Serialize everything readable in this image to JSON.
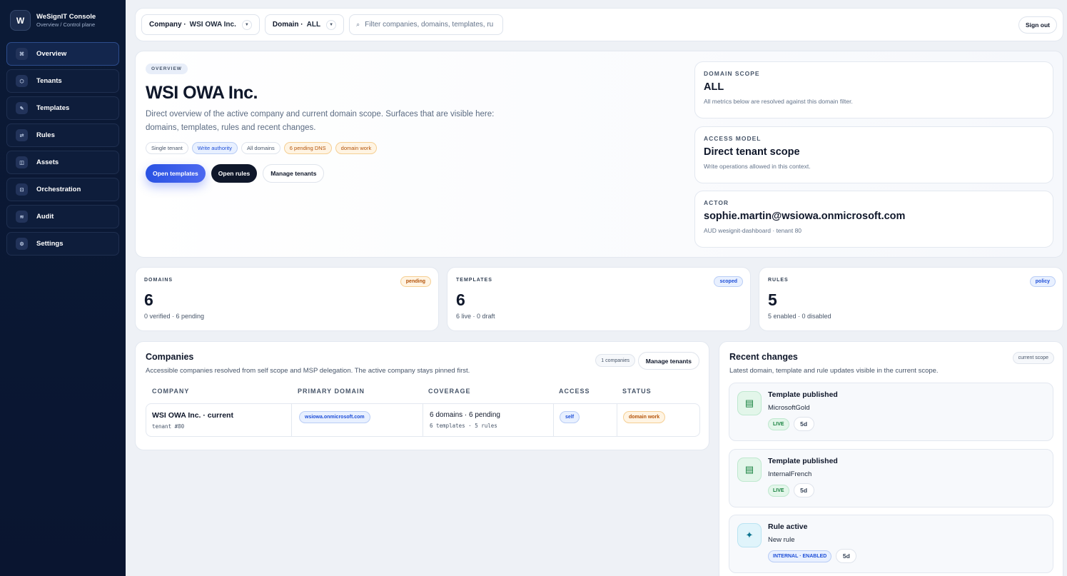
{
  "app": {
    "title": "WeSignIT Console",
    "subtitle": "Overview / Control plane",
    "logo_letter": "W"
  },
  "sidebar": {
    "items": [
      {
        "label": "Overview",
        "icon": "⌘",
        "icon_name": "overview-icon",
        "active": true
      },
      {
        "label": "Tenants",
        "icon": "⬡",
        "icon_name": "tenants-icon"
      },
      {
        "label": "Templates",
        "icon": "✎",
        "icon_name": "templates-icon"
      },
      {
        "label": "Rules",
        "icon": "⇄",
        "icon_name": "rules-icon"
      },
      {
        "label": "Assets",
        "icon": "◫",
        "icon_name": "assets-icon"
      },
      {
        "label": "Orchestration",
        "icon": "⊡",
        "icon_name": "orchestration-icon"
      },
      {
        "label": "Audit",
        "icon": "≋",
        "icon_name": "audit-icon"
      },
      {
        "label": "Settings",
        "icon": "⚙",
        "icon_name": "settings-icon"
      }
    ]
  },
  "topbar": {
    "company_label": "Company ·",
    "company_value": "WSI OWA Inc.",
    "domain_label": "Domain ·",
    "domain_value": "ALL",
    "caret": "▼",
    "search_icon": "⌕",
    "search_placeholder": "Filter companies, domains, templates, rules",
    "signout": "Sign out"
  },
  "hero": {
    "badge": "OVERVIEW",
    "title": "WSI OWA Inc.",
    "description": "Direct overview of the active company and current domain scope. Surfaces that are visible here: domains, templates, rules and recent changes.",
    "chips": [
      "Single tenant",
      "Write authority",
      "All domains",
      "6 pending DNS",
      "domain work"
    ],
    "buttons": {
      "open_templates": "Open templates",
      "open_rules": "Open rules",
      "manage_tenants": "Manage tenants"
    }
  },
  "scope": {
    "domain": {
      "label": "DOMAIN SCOPE",
      "value": "ALL",
      "note": "All metrics below are resolved against this domain filter."
    },
    "access": {
      "label": "ACCESS MODEL",
      "value": "Direct tenant scope",
      "note": "Write operations allowed in this context."
    },
    "actor": {
      "label": "ACTOR",
      "value": "sophie.martin@wsiowa.onmicrosoft.com",
      "note": "AUD wesignit-dashboard · tenant 80"
    }
  },
  "stats": {
    "domains": {
      "label": "DOMAINS",
      "badge": "pending",
      "value": "6",
      "sub": "0 verified · 6 pending"
    },
    "templates": {
      "label": "TEMPLATES",
      "badge": "scoped",
      "value": "6",
      "sub": "6 live · 0 draft"
    },
    "rules": {
      "label": "RULES",
      "badge": "policy",
      "value": "5",
      "sub": "5 enabled · 0 disabled"
    }
  },
  "companies": {
    "title": "Companies",
    "description": "Accessible companies resolved from self scope and MSP delegation. The active company stays pinned first.",
    "count": "1 companies",
    "manage": "Manage tenants",
    "headers": [
      "COMPANY",
      "PRIMARY DOMAIN",
      "COVERAGE",
      "ACCESS",
      "STATUS"
    ],
    "rows": [
      {
        "name": "WSI OWA Inc. · current",
        "tenant": "tenant #80",
        "domain": "wsiowa.onmicrosoft.com",
        "coverage": "6 domains · 6 pending",
        "coverage_detail": "6 templates · 5 rules",
        "access": "self",
        "status": "domain work"
      }
    ]
  },
  "recent": {
    "title": "Recent changes",
    "description": "Latest domain, template and rule updates visible in the current scope.",
    "scope_chip": "current scope",
    "items": [
      {
        "title": "Template published",
        "sub": "MicrosoftGold",
        "tag": "LIVE",
        "age": "5d",
        "icon": "▤"
      },
      {
        "title": "Template published",
        "sub": "InternalFrench",
        "tag": "LIVE",
        "age": "5d",
        "icon": "▤"
      },
      {
        "title": "Rule active",
        "sub": "New rule",
        "tag": "INTERNAL · ENABLED",
        "age": "5d",
        "icon": "✦"
      }
    ]
  },
  "colors": {
    "sidebar_bg": "#0b1a36",
    "accent": "#2952e3",
    "page_bg": "#eef1f6"
  }
}
